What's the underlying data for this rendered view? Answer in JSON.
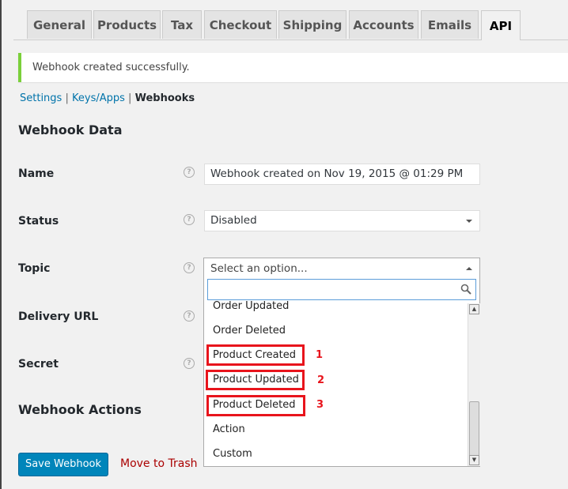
{
  "tabs": [
    {
      "label": "General"
    },
    {
      "label": "Products"
    },
    {
      "label": "Tax"
    },
    {
      "label": "Checkout"
    },
    {
      "label": "Shipping"
    },
    {
      "label": "Accounts"
    },
    {
      "label": "Emails"
    },
    {
      "label": "API",
      "active": true
    }
  ],
  "notice": "Webhook created successfully.",
  "subnav": {
    "settings": "Settings",
    "keys": "Keys/Apps",
    "webhooks": "Webhooks",
    "sep": "|"
  },
  "section_title": "Webhook Data",
  "fields": {
    "name_label": "Name",
    "name_value": "Webhook created on Nov 19, 2015 @ 01:29 PM",
    "status_label": "Status",
    "status_value": "Disabled",
    "topic_label": "Topic",
    "topic_placeholder": "Select an option...",
    "delivery_label": "Delivery URL",
    "secret_label": "Secret",
    "help": "?"
  },
  "topic_options": [
    "Order Updated",
    "Order Deleted",
    "Product Created",
    "Product Updated",
    "Product Deleted",
    "Action",
    "Custom"
  ],
  "annotations": [
    "1",
    "2",
    "3"
  ],
  "actions_title": "Webhook Actions",
  "save_label": "Save Webhook",
  "trash_label": "Move to Trash",
  "colors": {
    "accent": "#0085ba",
    "success": "#7ad03a",
    "annotation": "#e8141c",
    "trash": "#aa0000"
  }
}
